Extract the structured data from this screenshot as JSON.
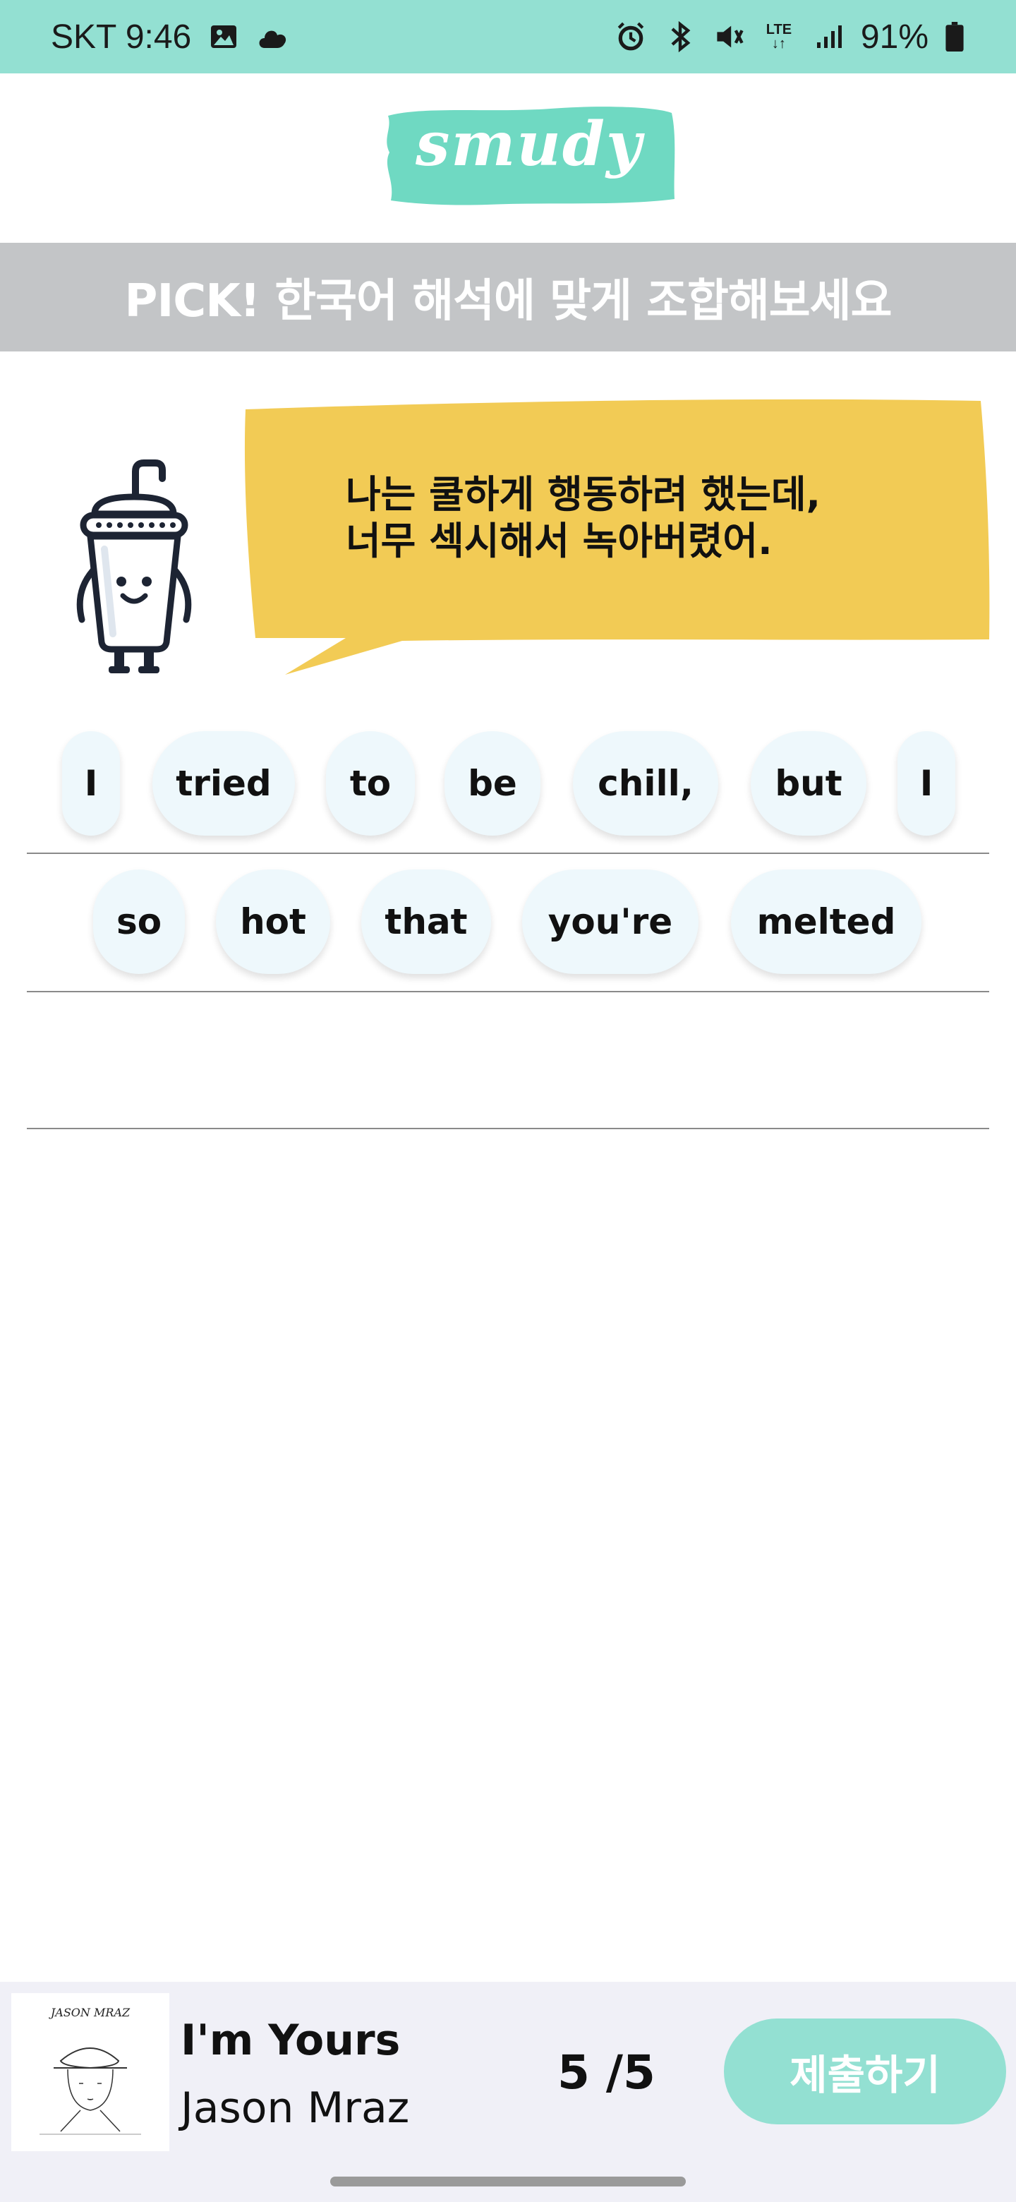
{
  "status_bar": {
    "carrier_time": "SKT 9:46",
    "network": "LTE",
    "battery": "91%",
    "left_icons": [
      "image-icon",
      "cloud-icon"
    ],
    "right_icons": [
      "alarm-icon",
      "bluetooth-icon",
      "mute-icon",
      "lte-icon",
      "signal-icon",
      "battery-icon"
    ]
  },
  "app": {
    "logo_text": "smudy",
    "accent_color": "#93E0D2",
    "logo_color": "#6FD9C2"
  },
  "banner": {
    "text": "PICK! 한국어 해석에 맞게 조합해보세요"
  },
  "prompt": {
    "line1": "나는 쿨하게 행동하려 했는데,",
    "line2": "너무 섹시해서 녹아버렸어.",
    "bubble_color": "#F2CB55"
  },
  "words": {
    "row1": [
      "I",
      "tried",
      "to",
      "be",
      "chill,",
      "but",
      "I"
    ],
    "row2": [
      "so",
      "hot",
      "that",
      "you're",
      "melted"
    ]
  },
  "song": {
    "title": "I'm Yours",
    "artist": "Jason Mraz",
    "album_cover_text": "JASON MRAZ"
  },
  "progress": {
    "text": "5 /5"
  },
  "submit_label": "제출하기"
}
